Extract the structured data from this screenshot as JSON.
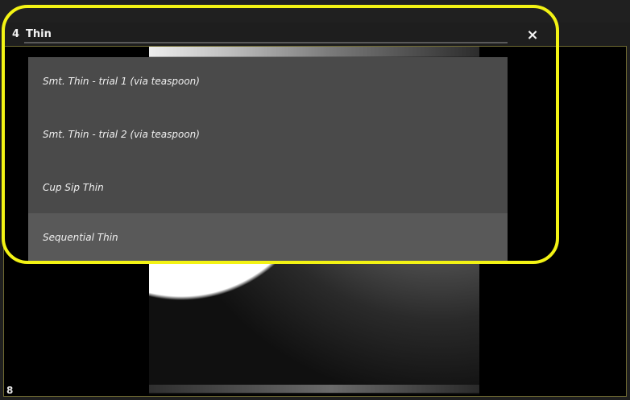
{
  "header": {
    "number": "4",
    "title": "Thin",
    "close_icon": "×"
  },
  "dropdown": {
    "items": [
      {
        "label": "Smt. Thin - trial 1 (via teaspoon)"
      },
      {
        "label": "Smt. Thin - trial 2 (via teaspoon)"
      },
      {
        "label": "Cup Sip Thin"
      },
      {
        "label": "Sequential Thin"
      }
    ],
    "selected_index": 3
  },
  "viewer": {
    "bottom_left_label": "8"
  },
  "colors": {
    "highlight": "#f3f314",
    "dropdown_bg": "#4a4a4a",
    "selected_item_bg": "#595959",
    "frame_border": "#6f6a32"
  },
  "icons": {
    "close": "close-icon"
  }
}
